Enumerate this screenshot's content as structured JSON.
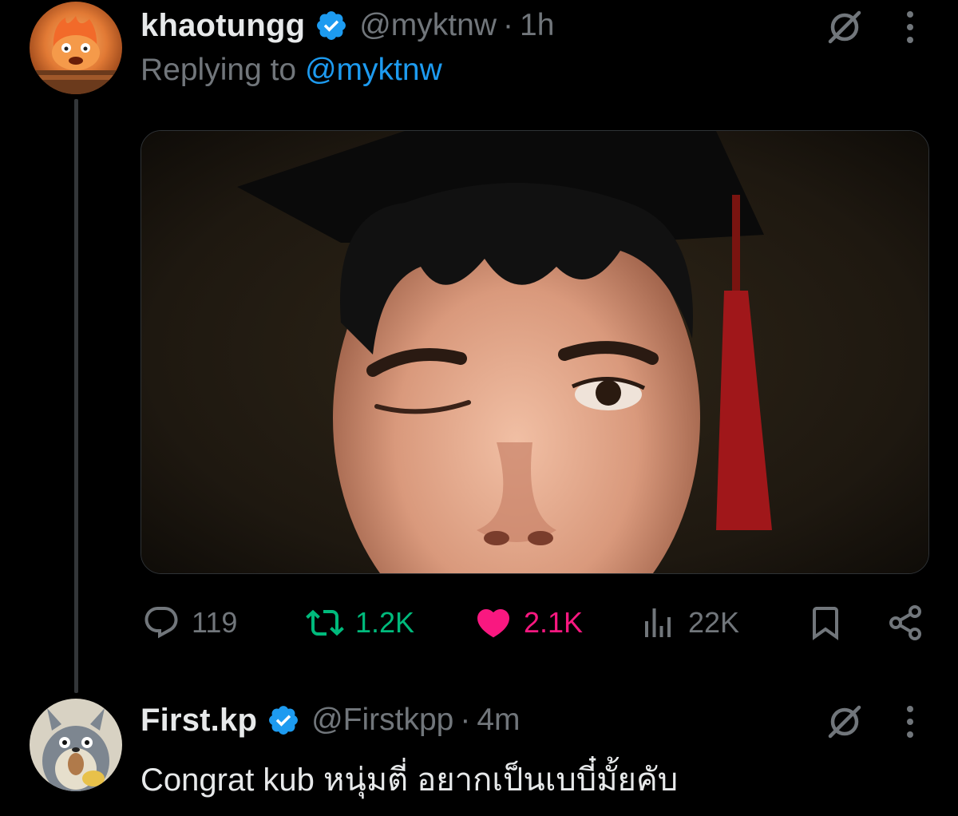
{
  "tweet1": {
    "display_name": "khaotungg",
    "handle": "@myktnw",
    "separator": "·",
    "time": "1h",
    "replying_prefix": "Replying to",
    "replying_mention": "@myktnw",
    "media_icon": "photo",
    "actions": {
      "replies": "119",
      "retweets": "1.2K",
      "likes": "2.1K",
      "views": "22K"
    },
    "icons": [
      "grok-icon",
      "more-icon",
      "reply-icon",
      "retweet-icon",
      "heart-icon",
      "views-icon",
      "bookmark-icon",
      "share-icon"
    ]
  },
  "tweet2": {
    "display_name": "First.kp",
    "handle": "@Firstkpp",
    "separator": "·",
    "time": "4m",
    "text": "Congrat kub หนุ่มตี่ อยากเป็นเบบี๋มั้ยคับ"
  },
  "colors": {
    "background": "#000000",
    "text": "#e7e9ea",
    "secondary": "#71767b",
    "accent": "#1d9bf0",
    "retweet": "#00ba7c",
    "like": "#f91880"
  }
}
